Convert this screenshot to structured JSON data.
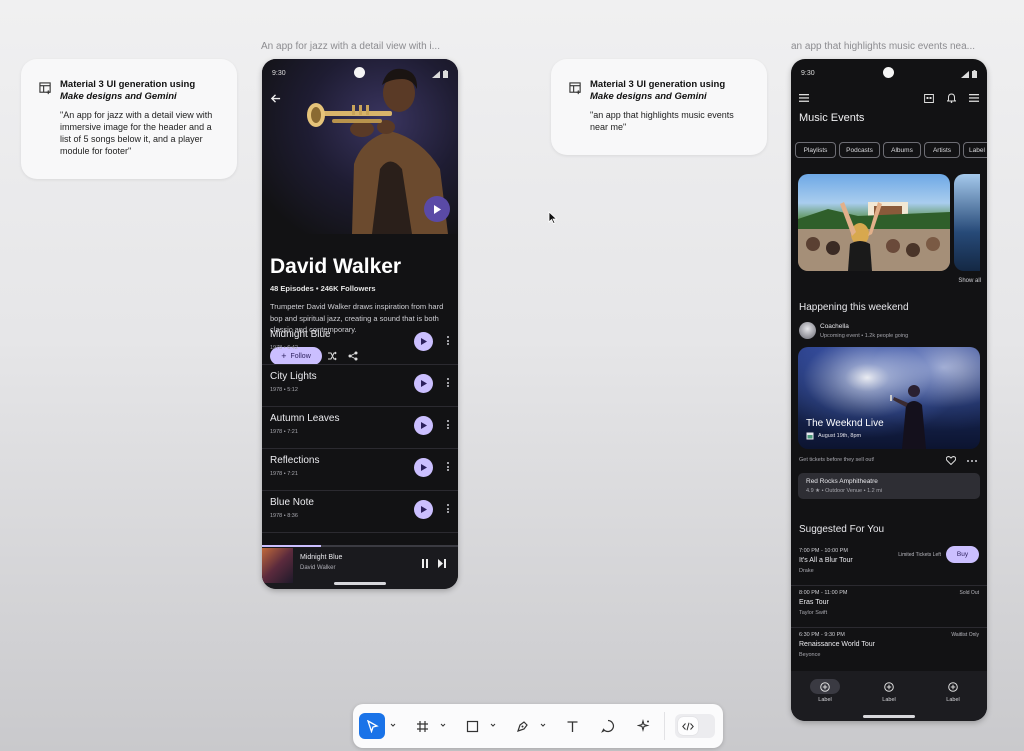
{
  "frames": {
    "jazz_label": "An app for jazz with a detail view with i...",
    "events_label": "an app that highlights music events nea..."
  },
  "prompts": [
    {
      "title": "Material 3 UI generation using",
      "title_em": "Make designs and Gemini",
      "text": "\"An app for jazz with a detail view with immersive image for the header and a list of 5 songs below it, and a player module for footer\""
    },
    {
      "title": "Material 3 UI generation using",
      "title_em": "Make designs and Gemini",
      "text": "\"an app that highlights music events near me\""
    }
  ],
  "jazz_app": {
    "status_time": "9:30",
    "artist_name": "David Walker",
    "stats": "48 Episodes • 246K Followers",
    "bio": "Trumpeter David Walker draws inspiration from hard bop and spiritual jazz, creating a sound that is both classic and contemporary.",
    "follow_label": "Follow",
    "songs": [
      {
        "title": "Midnight Blue",
        "meta": "1978 • 6:42"
      },
      {
        "title": "City Lights",
        "meta": "1978 • 5:12"
      },
      {
        "title": "Autumn Leaves",
        "meta": "1978 • 7:21"
      },
      {
        "title": "Reflections",
        "meta": "1978 • 7:21"
      },
      {
        "title": "Blue Note",
        "meta": "1978 • 8:36"
      }
    ],
    "player": {
      "title": "Midnight Blue",
      "artist": "David Walker",
      "progress": 0.3
    }
  },
  "events_app": {
    "status_time": "9:30",
    "title": "Music Events",
    "chips": [
      "Playlists",
      "Podcasts",
      "Albums",
      "Artists",
      "Label"
    ],
    "show_all": "Show all",
    "happening_heading": "Happening this weekend",
    "organizer": {
      "name": "Coachella",
      "meta": "Upcoming event • 1.2k people going"
    },
    "featured": {
      "title": "The Weeknd Live",
      "date": "August 19th, 8pm"
    },
    "tickets_note": "Get tickets before they sell out!",
    "venue": {
      "name": "Red Rocks Amphitheatre",
      "meta": "4.9 ★ • Outdoor Venue • 1.2 mi"
    },
    "suggested_heading": "Suggested For You",
    "suggestions": [
      {
        "time": "7:00 PM - 10:00 PM",
        "title": "It's All a Blur Tour",
        "artist": "Drake",
        "status": "Limited Tickets Left",
        "action": "Buy"
      },
      {
        "time": "8:00 PM - 11:00 PM",
        "title": "Eras Tour",
        "artist": "Taylor Swift",
        "status": "Sold Out"
      },
      {
        "time": "6:30 PM - 9:30 PM",
        "title": "Renaissance World Tour",
        "artist": "Beyonce",
        "status": "Waitlist Only"
      }
    ],
    "nav": [
      "Label",
      "Label",
      "Label"
    ]
  },
  "colors": {
    "accent": "#cbbfff",
    "fab": "#5a4aa6",
    "phone_bg": "#121214",
    "toolbar_active": "#1a73e8"
  },
  "toolbar": {
    "tools": [
      "move-icon",
      "frame-icon",
      "rectangle-icon",
      "pen-icon",
      "text-icon",
      "comment-icon",
      "actions-icon",
      "dev-mode-icon"
    ]
  }
}
